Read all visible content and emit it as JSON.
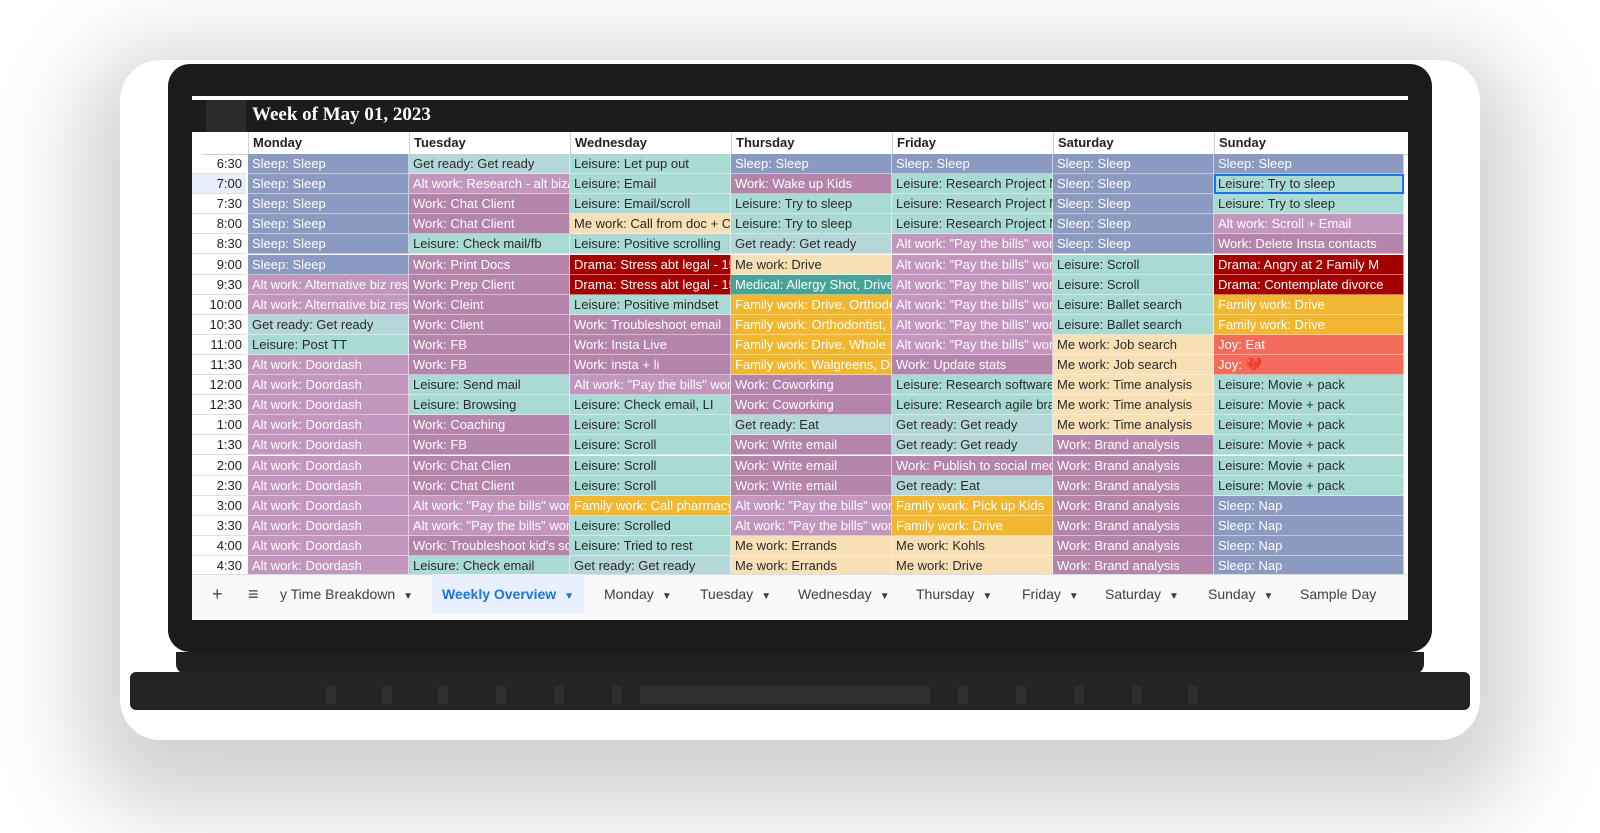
{
  "sheet": {
    "week_title": "Week of May 01, 2023",
    "days": [
      "Monday",
      "Tuesday",
      "Wednesday",
      "Thursday",
      "Friday",
      "Saturday",
      "Sunday"
    ],
    "times": [
      "6:30",
      "7:00",
      "7:30",
      "8:00",
      "8:30",
      "9:00",
      "9:30",
      "10:00",
      "10:30",
      "11:00",
      "11:30",
      "12:00",
      "12:30",
      "1:00",
      "1:30",
      "2:00",
      "2:30",
      "3:00",
      "3:30",
      "4:00",
      "4:30"
    ],
    "colors": {
      "sleep": "#8b9ac0",
      "work": "#b584ab",
      "leisure": "#aadad4",
      "getready": "#b6d7d9",
      "drama": "#a30000",
      "family": "#f2b731",
      "mework": "#f7dfb6",
      "joy": "#f26b5b",
      "medical": "#45a397",
      "altwork": "#c296bd"
    },
    "schedule": [
      [
        [
          "Sleep: Sleep",
          "sleep"
        ],
        [
          "Get ready: Get ready",
          "getready"
        ],
        [
          "Leisure: Let pup out",
          "leisure"
        ],
        [
          "Sleep: Sleep",
          "sleep"
        ],
        [
          "Sleep: Sleep",
          "sleep"
        ],
        [
          "Sleep: Sleep",
          "sleep"
        ],
        [
          "Sleep: Sleep",
          "sleep"
        ]
      ],
      [
        [
          "Sleep: Sleep",
          "sleep"
        ],
        [
          "Alt work: Research - alt biz/",
          "altwork"
        ],
        [
          "Leisure: Email",
          "leisure"
        ],
        [
          "Work: Wake up Kids",
          "work"
        ],
        [
          "Leisure: Research Project M",
          "leisure"
        ],
        [
          "Sleep: Sleep",
          "sleep"
        ],
        [
          "Leisure: Try to sleep",
          "leisure"
        ]
      ],
      [
        [
          "Sleep: Sleep",
          "sleep"
        ],
        [
          "Work: Chat Client",
          "work"
        ],
        [
          "Leisure: Email/scroll",
          "leisure"
        ],
        [
          "Leisure: Try to sleep",
          "leisure"
        ],
        [
          "Leisure: Research Project M",
          "leisure"
        ],
        [
          "Sleep: Sleep",
          "sleep"
        ],
        [
          "Leisure: Try to sleep",
          "leisure"
        ]
      ],
      [
        [
          "Sleep: Sleep",
          "sleep"
        ],
        [
          "Work: Chat Client",
          "work"
        ],
        [
          "Me work: Call from doc + Ca",
          "mework"
        ],
        [
          "Leisure: Try to sleep",
          "leisure"
        ],
        [
          "Leisure: Research Project M",
          "leisure"
        ],
        [
          "Sleep: Sleep",
          "sleep"
        ],
        [
          "Alt work: Scroll + Email",
          "altwork"
        ]
      ],
      [
        [
          "Sleep: Sleep",
          "sleep"
        ],
        [
          "Leisure: Check mail/fb",
          "leisure"
        ],
        [
          "Leisure: Positive scrolling",
          "leisure"
        ],
        [
          "Get ready: Get ready",
          "getready"
        ],
        [
          "Alt work: \"Pay the bills\" work",
          "altwork"
        ],
        [
          "Sleep: Sleep",
          "sleep"
        ],
        [
          "Work: Delete Insta contacts",
          "work"
        ]
      ],
      [
        [
          "Sleep: Sleep",
          "sleep"
        ],
        [
          "Work: Print Docs",
          "work"
        ],
        [
          "Drama: Stress abt legal - 15",
          "drama"
        ],
        [
          "Me work: Drive",
          "mework"
        ],
        [
          "Alt work: \"Pay the bills\" work",
          "altwork"
        ],
        [
          "Leisure: Scroll",
          "leisure"
        ],
        [
          "Drama: Angry at 2 Family M",
          "drama"
        ]
      ],
      [
        [
          "Alt work: Alternative biz res",
          "altwork"
        ],
        [
          "Work: Prep Client",
          "work"
        ],
        [
          "Drama: Stress abt legal - 15",
          "drama"
        ],
        [
          "Medical: Allergy Shot, Drive",
          "medical"
        ],
        [
          "Alt work: \"Pay the bills\" work",
          "altwork"
        ],
        [
          "Leisure: Scroll",
          "leisure"
        ],
        [
          "Drama: Contemplate divorce",
          "drama"
        ]
      ],
      [
        [
          "Alt work: Alternative biz res",
          "altwork"
        ],
        [
          "Work: Cleint",
          "work"
        ],
        [
          "Leisure: Positive mindset",
          "leisure"
        ],
        [
          "Family work: Drive, Orthodo",
          "family"
        ],
        [
          "Alt work: \"Pay the bills\" work",
          "altwork"
        ],
        [
          "Leisure: Ballet search",
          "leisure"
        ],
        [
          "Family work: Drive",
          "family"
        ]
      ],
      [
        [
          "Get ready: Get ready",
          "getready"
        ],
        [
          "Work: Client",
          "work"
        ],
        [
          "Work: Troubleshoot email",
          "work"
        ],
        [
          "Family work: Orthodontist, D",
          "family"
        ],
        [
          "Alt work: \"Pay the bills\" work",
          "altwork"
        ],
        [
          "Leisure: Ballet search",
          "leisure"
        ],
        [
          "Family work: Drive",
          "family"
        ]
      ],
      [
        [
          "Leisure: Post TT",
          "leisure"
        ],
        [
          "Work: FB",
          "work"
        ],
        [
          "Work: Insta Live",
          "work"
        ],
        [
          "Family work: Drive, Whole F",
          "family"
        ],
        [
          "Alt work: \"Pay the bills\" work",
          "altwork"
        ],
        [
          "Me work: Job search",
          "mework"
        ],
        [
          "Joy: Eat",
          "joy"
        ]
      ],
      [
        [
          "Alt work: Doordash",
          "altwork"
        ],
        [
          "Work: FB",
          "work"
        ],
        [
          "Work: insta + li",
          "work"
        ],
        [
          "Family work: Walgreens, Dr",
          "family"
        ],
        [
          "Work: Update stats",
          "work"
        ],
        [
          "Me work: Job search",
          "mework"
        ],
        [
          "Joy: 💔",
          "joy"
        ]
      ],
      [
        [
          "Alt work: Doordash",
          "altwork"
        ],
        [
          "Leisure: Send mail",
          "leisure"
        ],
        [
          "Alt work: \"Pay the bills\" work",
          "altwork"
        ],
        [
          "Work: Coworking",
          "work"
        ],
        [
          "Leisure: Research software",
          "leisure"
        ],
        [
          "Me work: Time analysis",
          "mework"
        ],
        [
          "Leisure: Movie + pack",
          "leisure"
        ]
      ],
      [
        [
          "Alt work: Doordash",
          "altwork"
        ],
        [
          "Leisure: Browsing",
          "leisure"
        ],
        [
          "Leisure: Check email, LI",
          "leisure"
        ],
        [
          "Work: Coworking",
          "work"
        ],
        [
          "Leisure: Research agile bra",
          "leisure"
        ],
        [
          "Me work: Time analysis",
          "mework"
        ],
        [
          "Leisure: Movie + pack",
          "leisure"
        ]
      ],
      [
        [
          "Alt work: Doordash",
          "altwork"
        ],
        [
          "Work: Coaching",
          "work"
        ],
        [
          "Leisure: Scroll",
          "leisure"
        ],
        [
          "Get ready: Eat",
          "getready"
        ],
        [
          "Get ready: Get ready",
          "getready"
        ],
        [
          "Me work: Time analysis",
          "mework"
        ],
        [
          "Leisure: Movie + pack",
          "leisure"
        ]
      ],
      [
        [
          "Alt work: Doordash",
          "altwork"
        ],
        [
          "Work: FB",
          "work"
        ],
        [
          "Leisure: Scroll",
          "leisure"
        ],
        [
          "Work: Write email",
          "work"
        ],
        [
          "Get ready: Get ready",
          "getready"
        ],
        [
          "Work: Brand analysis",
          "work"
        ],
        [
          "Leisure: Movie + pack",
          "leisure"
        ]
      ],
      [
        [
          "Alt work: Doordash",
          "altwork"
        ],
        [
          "Work: Chat Clien",
          "work"
        ],
        [
          "Leisure: Scroll",
          "leisure"
        ],
        [
          "Work: Write email",
          "work"
        ],
        [
          "Work: Publish to social med",
          "work"
        ],
        [
          "Work: Brand analysis",
          "work"
        ],
        [
          "Leisure: Movie + pack",
          "leisure"
        ]
      ],
      [
        [
          "Alt work: Doordash",
          "altwork"
        ],
        [
          "Work: Chat Client",
          "work"
        ],
        [
          "Leisure: Scroll",
          "leisure"
        ],
        [
          "Work: Write email",
          "work"
        ],
        [
          "Get ready: Eat",
          "getready"
        ],
        [
          "Work: Brand analysis",
          "work"
        ],
        [
          "Leisure: Movie + pack",
          "leisure"
        ]
      ],
      [
        [
          "Alt work: Doordash",
          "altwork"
        ],
        [
          "Alt work: \"Pay the bills\" work",
          "altwork"
        ],
        [
          "Family work: Call pharmacy",
          "family"
        ],
        [
          "Alt work: \"Pay the bills\" work",
          "altwork"
        ],
        [
          "Family work: Pick up Kids",
          "family"
        ],
        [
          "Work: Brand analysis",
          "work"
        ],
        [
          "Sleep: Nap",
          "sleep"
        ]
      ],
      [
        [
          "Alt work: Doordash",
          "altwork"
        ],
        [
          "Alt work: \"Pay the bills\" work",
          "altwork"
        ],
        [
          "Leisure: Scrolled",
          "leisure"
        ],
        [
          "Alt work: \"Pay the bills\" work",
          "altwork"
        ],
        [
          "Family work: Drive",
          "family"
        ],
        [
          "Work: Brand analysis",
          "work"
        ],
        [
          "Sleep: Nap",
          "sleep"
        ]
      ],
      [
        [
          "Alt work: Doordash",
          "altwork"
        ],
        [
          "Work: Troubleshoot kid's sc",
          "work"
        ],
        [
          "Leisure: Tried to rest",
          "leisure"
        ],
        [
          "Me work: Errands",
          "mework"
        ],
        [
          "Me work: Kohls",
          "mework"
        ],
        [
          "Work: Brand analysis",
          "work"
        ],
        [
          "Sleep: Nap",
          "sleep"
        ]
      ],
      [
        [
          "Alt work: Doordash",
          "altwork"
        ],
        [
          "Leisure: Check email",
          "leisure"
        ],
        [
          "Get ready: Get ready",
          "getready"
        ],
        [
          "Me work: Errands",
          "mework"
        ],
        [
          "Me work: Drive",
          "mework"
        ],
        [
          "Work: Brand analysis",
          "work"
        ],
        [
          "Sleep: Nap",
          "sleep"
        ]
      ]
    ]
  },
  "tabs": {
    "add_icon": "+",
    "menu_icon": "≡",
    "items": [
      {
        "label": "y Time Breakdown",
        "active": false
      },
      {
        "label": "Weekly Overview",
        "active": true
      },
      {
        "label": "Monday",
        "active": false
      },
      {
        "label": "Tuesday",
        "active": false
      },
      {
        "label": "Wednesday",
        "active": false
      },
      {
        "label": "Thursday",
        "active": false
      },
      {
        "label": "Friday",
        "active": false
      },
      {
        "label": "Saturday",
        "active": false
      },
      {
        "label": "Sunday",
        "active": false
      },
      {
        "label": "Sample Day",
        "active": false
      }
    ]
  }
}
